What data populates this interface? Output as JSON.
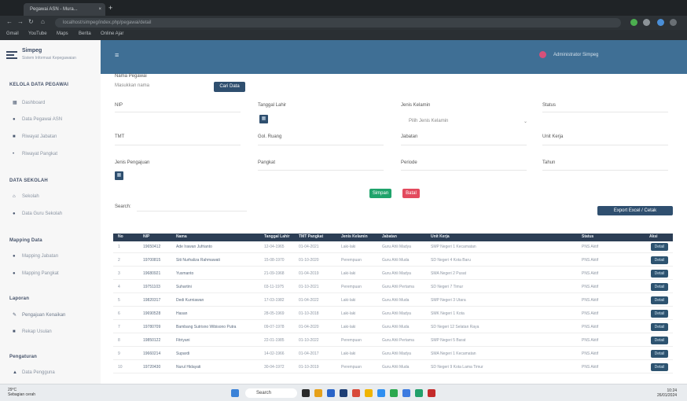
{
  "browser": {
    "tab_title": "Pegawai ASN - Mura...",
    "tab_close": "×",
    "new_tab": "+",
    "url": "localhost/simpeg/index.php/pegawai/detail",
    "bookmarks": [
      "Gmail",
      "YouTube",
      "Maps",
      "Berita",
      "Online Ajar"
    ]
  },
  "app": {
    "brand_title": "Simpeg",
    "brand_subtitle": "Sistem Informasi Kepegawaian",
    "sidebar": [
      {
        "type": "section",
        "label": "KELOLA DATA PEGAWAI"
      },
      {
        "type": "item",
        "label": "Dashboard",
        "icon": "grid-icon"
      },
      {
        "type": "item",
        "label": "Data Pegawai ASN",
        "icon": "users-icon"
      },
      {
        "type": "item",
        "label": "Riwayat Jabatan",
        "icon": "list-icon"
      },
      {
        "type": "item",
        "label": "Riwayat Pangkat",
        "icon": "star-icon"
      },
      {
        "type": "section",
        "label": "DATA SEKOLAH"
      },
      {
        "type": "item",
        "label": "Sekolah",
        "icon": "school-icon"
      },
      {
        "type": "item",
        "label": "Data Guru Sekolah",
        "icon": "people-icon"
      },
      {
        "type": "section",
        "label": "Mapping Data"
      },
      {
        "type": "item",
        "label": "Mapping Jabatan",
        "icon": "dot-icon"
      },
      {
        "type": "item",
        "label": "Mapping Pangkat",
        "icon": "dot-icon"
      },
      {
        "type": "section",
        "label": "Laporan"
      },
      {
        "type": "item",
        "label": "Pengajuan Kenaikan",
        "icon": "file-icon",
        "active": true
      },
      {
        "type": "item",
        "label": "Rekap Usulan",
        "icon": "chart-icon"
      },
      {
        "type": "section",
        "label": "Pengaturan"
      },
      {
        "type": "item",
        "label": "Data Pengguna",
        "icon": "user-icon"
      }
    ],
    "menu_icon": "≡",
    "user_name": "Administrator Simpeg"
  },
  "filter": {
    "nama_label": "Nama Pegawai",
    "nama_value": "Masukkan nama",
    "cari_button": "Cari Data",
    "fields_row1": [
      {
        "label": "NIP",
        "value": ""
      },
      {
        "label": "Tanggal Lahir",
        "value": ""
      },
      {
        "label": "Jenis Kelamin",
        "value": "Pilih Jenis Kelamin"
      },
      {
        "label": "Status",
        "value": ""
      }
    ],
    "fields_row2": [
      {
        "label": "TMT",
        "value": ""
      },
      {
        "label": "Gol. Ruang",
        "value": ""
      },
      {
        "label": "Jabatan",
        "value": ""
      },
      {
        "label": "Unit Kerja",
        "value": ""
      }
    ],
    "fields_row3": [
      {
        "label": "Jenis Pengajuan",
        "value": ""
      },
      {
        "label": "Pangkat",
        "value": ""
      },
      {
        "label": "Periode",
        "value": ""
      },
      {
        "label": "Tahun",
        "value": ""
      }
    ],
    "submit_button": "Simpan",
    "reset_button": "Batal",
    "search_label": "Search:",
    "export_button": "Export Excel / Cetak"
  },
  "table": {
    "columns": [
      "No",
      "NIP",
      "Nama",
      "Tanggal Lahir",
      "TMT Pangkat",
      "Jenis Kelamin",
      "Jabatan",
      "Unit Kerja",
      "Status",
      "Aksi"
    ],
    "action_label": "Detail",
    "rows": [
      [
        "1",
        "19650412",
        "Ade Irawan Jufrianto",
        "12-04-1965",
        "01-04-2021",
        "Laki-laki",
        "Guru Ahli Madya",
        "SMP Negeri 1 Kecamatan",
        "PNS Aktif"
      ],
      [
        "2",
        "19700815",
        "Siti Nurhaliza Rahmawati",
        "15-08-1970",
        "01-10-2020",
        "Perempuan",
        "Guru Ahli Muda",
        "SD Negeri 4 Kota Baru",
        "PNS Aktif"
      ],
      [
        "3",
        "19680921",
        "Yusmanto",
        "21-09-1968",
        "01-04-2019",
        "Laki-laki",
        "Guru Ahli Madya",
        "SMA Negeri 2 Pusat",
        "PNS Aktif"
      ],
      [
        "4",
        "19751103",
        "Suhartini",
        "03-11-1975",
        "01-10-2021",
        "Perempuan",
        "Guru Ahli Pertama",
        "SD Negeri 7 Timur",
        "PNS Aktif"
      ],
      [
        "5",
        "19820317",
        "Dedi Kurniawan",
        "17-03-1982",
        "01-04-2022",
        "Laki-laki",
        "Guru Ahli Muda",
        "SMP Negeri 3 Utara",
        "PNS Aktif"
      ],
      [
        "6",
        "19690528",
        "Hasan",
        "28-05-1969",
        "01-10-2018",
        "Laki-laki",
        "Guru Ahli Madya",
        "SMK Negeri 1 Kota",
        "PNS Aktif"
      ],
      [
        "7",
        "19780709",
        "Bambang Sutrisno Wibisono Putra",
        "09-07-1978",
        "01-04-2020",
        "Laki-laki",
        "Guru Ahli Muda",
        "SD Negeri 12 Selatan Raya",
        "PNS Aktif"
      ],
      [
        "8",
        "19850122",
        "Fitriyani",
        "22-01-1985",
        "01-10-2022",
        "Perempuan",
        "Guru Ahli Pertama",
        "SMP Negeri 5 Barat",
        "PNS Aktif"
      ],
      [
        "9",
        "19660214",
        "Supardi",
        "14-02-1966",
        "01-04-2017",
        "Laki-laki",
        "Guru Ahli Madya",
        "SMA Negeri 1 Kecamatan",
        "PNS Aktif"
      ],
      [
        "10",
        "19720430",
        "Nurul Hidayati",
        "30-04-1972",
        "01-10-2019",
        "Perempuan",
        "Guru Ahli Muda",
        "SD Negeri 9 Kota Lama Timur",
        "PNS Aktif"
      ]
    ]
  },
  "taskbar": {
    "weather_temp": "29°C",
    "weather_desc": "Sebagian cerah",
    "search_label": "Search",
    "time": "10:24",
    "date": "26/01/2024"
  },
  "colors": {
    "topbar": "#3f6f95",
    "primary": "#2f4f6f",
    "success": "#1fa36b",
    "danger": "#e34a5e",
    "table_head": "#2c3e55"
  }
}
